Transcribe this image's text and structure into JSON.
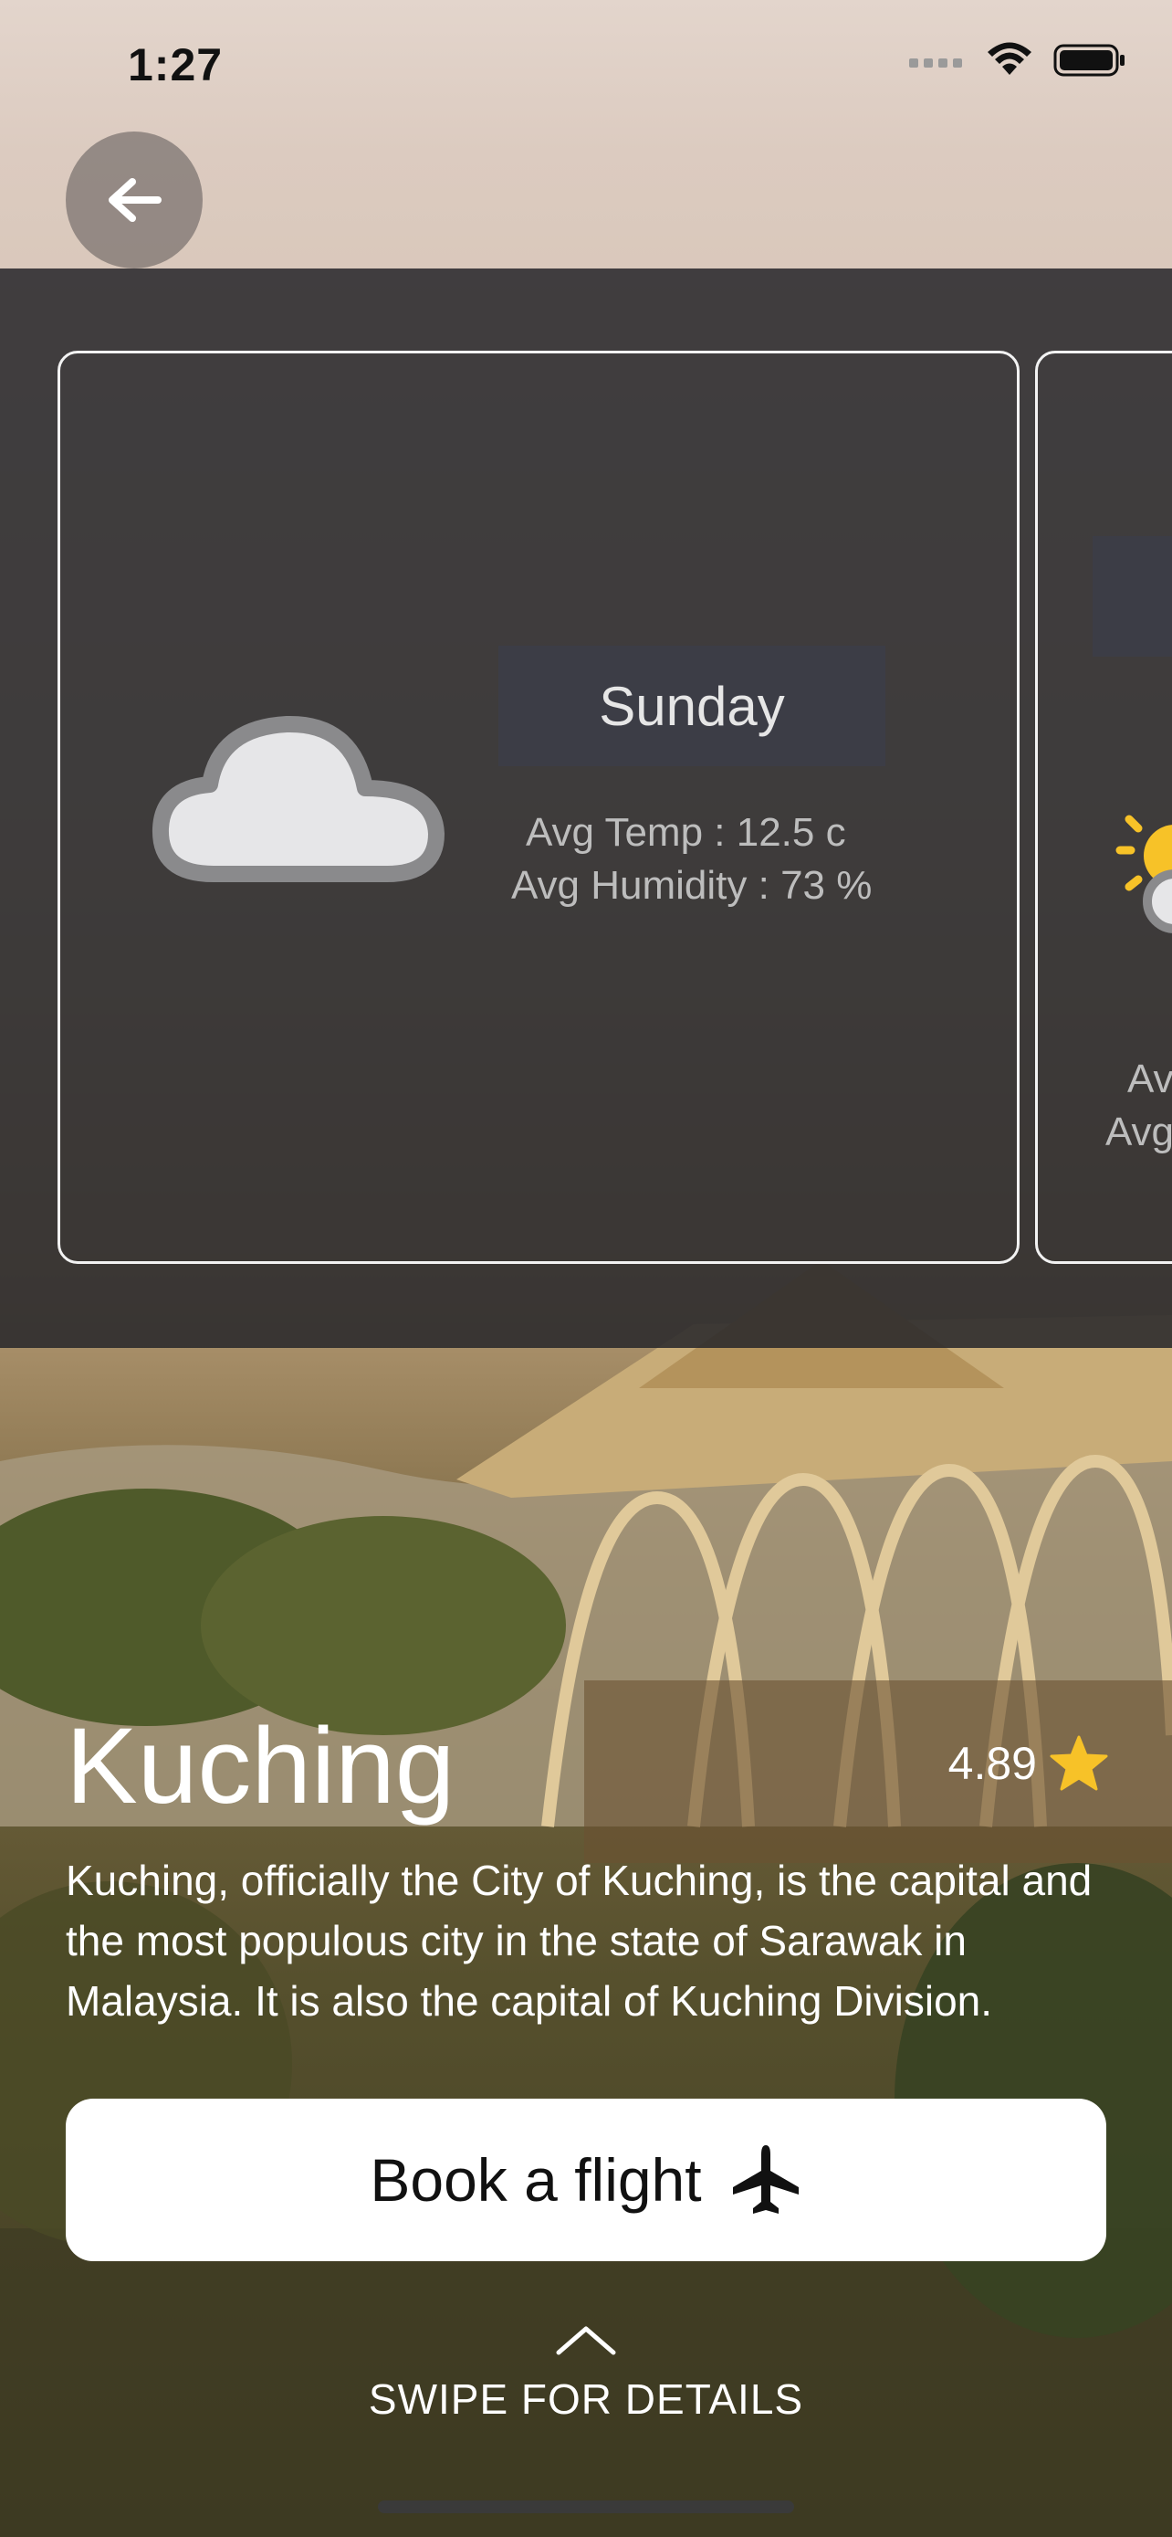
{
  "status_bar": {
    "time": "1:27"
  },
  "weather": {
    "cards": [
      {
        "day": "Sunday",
        "avg_temp": "Avg Temp : 12.5 c",
        "avg_humidity": "Avg Humidity : 73 %",
        "icon": "cloud-icon"
      },
      {
        "day": "",
        "avg_temp": "Av",
        "avg_humidity": "Avg",
        "icon": "sun-cloud-icon"
      }
    ]
  },
  "city": {
    "name": "Kuching",
    "rating": "4.89",
    "description": "Kuching, officially the City of Kuching, is the capital and the most populous city in the state of Sarawak in Malaysia. It is also the capital of Kuching Division."
  },
  "actions": {
    "book_label": "Book a flight",
    "book_icon": "airplane-icon"
  },
  "swipe": {
    "label": "SWIPE FOR DETAILS"
  },
  "colors": {
    "star": "#f7c228",
    "panel": "#26262a"
  }
}
